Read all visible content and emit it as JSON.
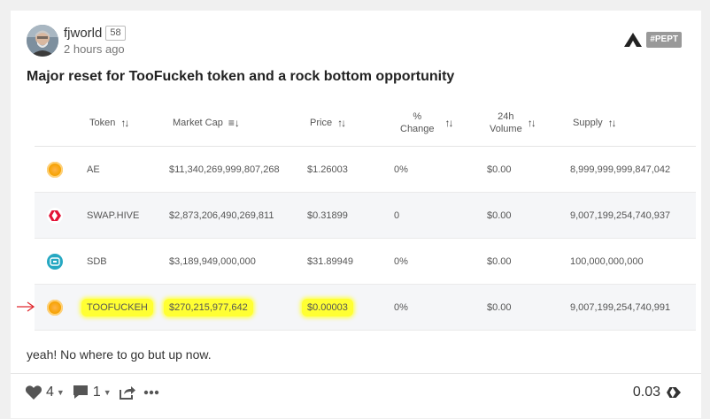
{
  "post": {
    "author": "fjworld",
    "reputation": "58",
    "time": "2 hours ago",
    "community_tag": "#PEPT",
    "title": "Major reset for TooFuckeh token and a rock bottom opportunity",
    "body": "yeah! No where to go but up now."
  },
  "table": {
    "headers": {
      "token": "Token",
      "market_cap": "Market Cap",
      "price": "Price",
      "change_line1": "%",
      "change_line2": "Change",
      "volume_line1": "24h",
      "volume_line2": "Volume",
      "supply": "Supply"
    },
    "rows": [
      {
        "icon": "ae-coin-icon",
        "token": "AE",
        "market_cap": "$11,340,269,999,807,268",
        "price": "$1.26003",
        "change": "0%",
        "volume": "$0.00",
        "supply": "8,999,999,999,847,042"
      },
      {
        "icon": "hive-coin-icon",
        "token": "SWAP.HIVE",
        "market_cap": "$2,873,206,490,269,811",
        "price": "$0.31899",
        "change": "0",
        "volume": "$0.00",
        "supply": "9,007,199,254,740,937"
      },
      {
        "icon": "sdb-coin-icon",
        "token": "SDB",
        "market_cap": "$3,189,949,000,000",
        "price": "$31.89949",
        "change": "0%",
        "volume": "$0.00",
        "supply": "100,000,000,000"
      },
      {
        "icon": "toofuckeh-coin-icon",
        "token": "TOOFUCKEH",
        "market_cap": "$270,215,977,642",
        "price": "$0.00003",
        "change": "0%",
        "volume": "$0.00",
        "supply": "9,007,199,254,740,991"
      }
    ]
  },
  "footer": {
    "votes": "4",
    "comments": "1",
    "payout": "0.03"
  },
  "colors": {
    "highlight": "#ffff33",
    "annotation_arrow": "#e0282e",
    "row_alt": "#f5f6f8"
  }
}
